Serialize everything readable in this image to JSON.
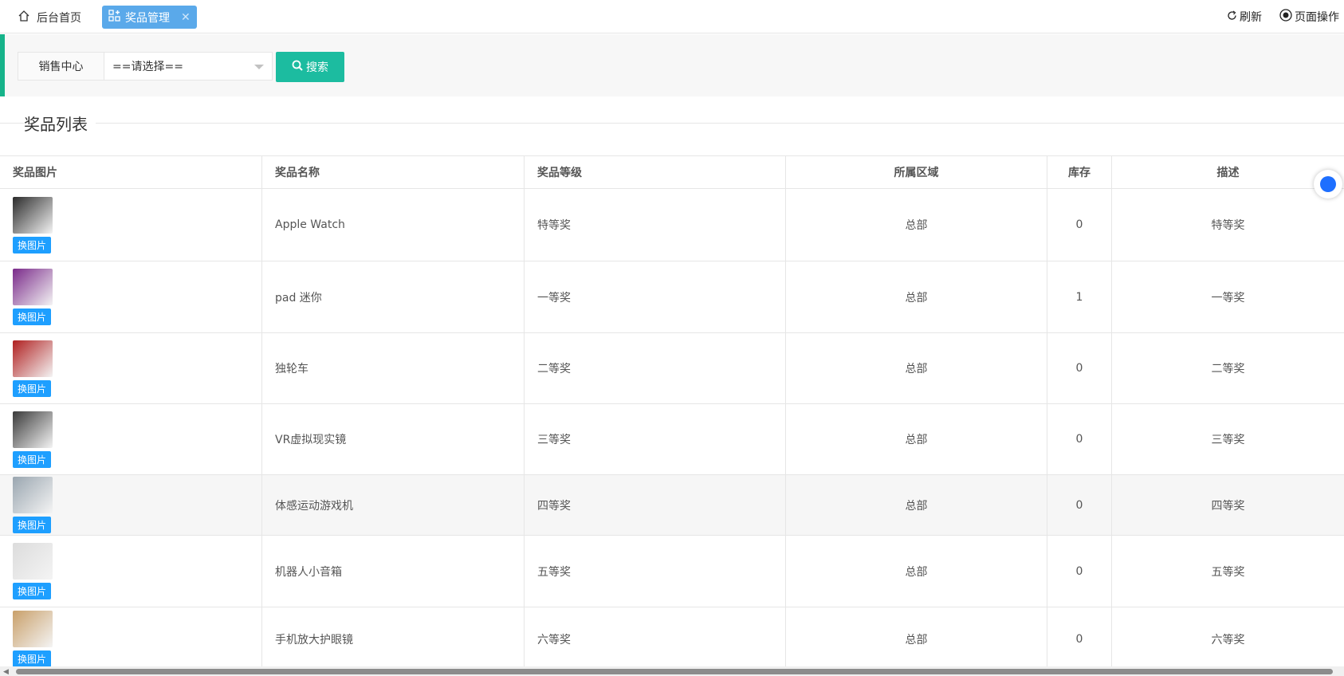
{
  "tabs": {
    "home_label": "后台首页",
    "active_label": "奖品管理",
    "close_symbol": "✕"
  },
  "top_actions": {
    "refresh_label": "刷新",
    "page_ops_label": "页面操作"
  },
  "search": {
    "field_label": "销售中心",
    "select_value": "==请选择==",
    "button_label": "搜索"
  },
  "section": {
    "title": "奖品列表"
  },
  "table": {
    "headers": [
      "奖品图片",
      "奖品名称",
      "奖品等级",
      "所属区域",
      "库存",
      "描述"
    ],
    "swap_label": "换图片",
    "rows": [
      {
        "name": "Apple Watch",
        "level": "特等奖",
        "region": "总部",
        "stock": "0",
        "desc": "特等奖",
        "thumb_icon": "watch-image",
        "thumb_color": "#2b2b2b"
      },
      {
        "name": "pad 迷你",
        "level": "一等奖",
        "region": "总部",
        "stock": "1",
        "desc": "一等奖",
        "thumb_icon": "tablet-image",
        "thumb_color": "#7a2a8a"
      },
      {
        "name": "独轮车",
        "level": "二等奖",
        "region": "总部",
        "stock": "0",
        "desc": "二等奖",
        "thumb_icon": "hoverboard-image",
        "thumb_color": "#b02020"
      },
      {
        "name": "VR虚拟现实镜",
        "level": "三等奖",
        "region": "总部",
        "stock": "0",
        "desc": "三等奖",
        "thumb_icon": "vr-headset-image",
        "thumb_color": "#3a3a3a"
      },
      {
        "name": "体感运动游戏机",
        "level": "四等奖",
        "region": "总部",
        "stock": "0",
        "desc": "四等奖",
        "thumb_icon": "game-console-image",
        "thumb_color": "#9aa6b0"
      },
      {
        "name": "机器人小音箱",
        "level": "五等奖",
        "region": "总部",
        "stock": "0",
        "desc": "五等奖",
        "thumb_icon": "robot-speaker-image",
        "thumb_color": "#dcdcdc"
      },
      {
        "name": "手机放大护眼镜",
        "level": "六等奖",
        "region": "总部",
        "stock": "0",
        "desc": "六等奖",
        "thumb_icon": "magnifier-image",
        "thumb_color": "#c9a06a"
      }
    ]
  },
  "colors": {
    "accent_green": "#16b38a",
    "search_button": "#1cbca0",
    "active_tab": "#5aa9ea",
    "swap_button": "#1e9fff"
  }
}
